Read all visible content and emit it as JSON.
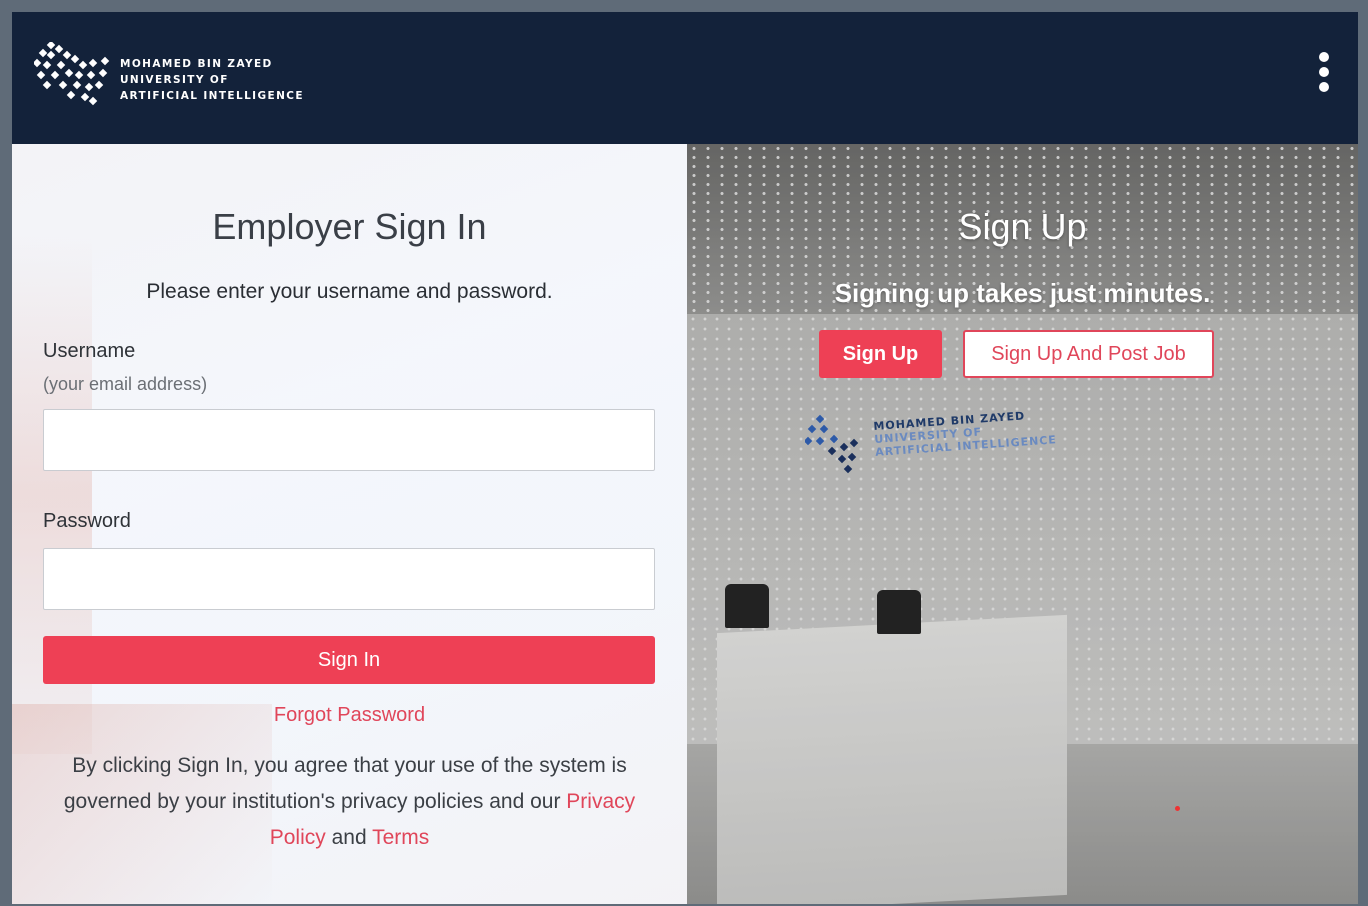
{
  "header": {
    "logo_line1": "MOHAMED BIN ZAYED",
    "logo_line2": "UNIVERSITY OF",
    "logo_line3": "ARTIFICIAL INTELLIGENCE",
    "menu_icon": "kebab-menu-icon"
  },
  "signin": {
    "title": "Employer Sign In",
    "subtitle": "Please enter your username and password.",
    "username_label": "Username",
    "username_hint": "(your email address)",
    "username_value": "",
    "password_label": "Password",
    "password_value": "",
    "button_label": "Sign In",
    "forgot_label": "Forgot Password",
    "agree_text": "By clicking Sign In, you agree that your use of the system is governed by your institution's privacy policies and our",
    "privacy_link": "Privacy Policy",
    "and_text": "and",
    "terms_link": "Terms"
  },
  "signup": {
    "title": "Sign Up",
    "subtitle": "Signing up takes just minutes.",
    "signup_button": "Sign Up",
    "signup_post_button": "Sign Up And Post Job",
    "wall_logo_line1": "MOHAMED BIN ZAYED",
    "wall_logo_line2": "UNIVERSITY OF",
    "wall_logo_line3": "ARTIFICIAL INTELLIGENCE"
  },
  "colors": {
    "header_bg": "#13223a",
    "accent": "#ee4055",
    "link": "#e0465a"
  }
}
